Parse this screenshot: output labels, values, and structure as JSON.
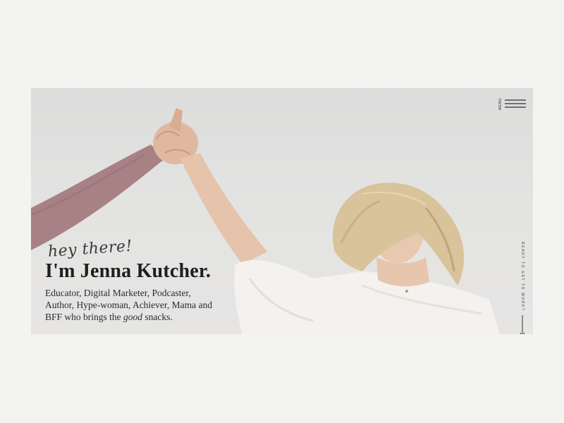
{
  "nav": {
    "menu_label": "MENU"
  },
  "hero": {
    "greeting": "hey there!",
    "headline": "I'm Jenna Kutcher.",
    "tagline_before": "Educator, Digital Marketer, Podcaster, Author, Hype-woman, Achiever, Mama and BFF who brings the ",
    "tagline_emphasis": "good",
    "tagline_after": " snacks.",
    "scroll_cue": "READY TO GET TO WORK?"
  },
  "icons": {
    "menu": "hamburger-icon",
    "scroll": "arrow-down-icon"
  },
  "colors": {
    "text": "#1e1e1e",
    "sleeve": "#a88184",
    "shirt": "#f4f2ee",
    "hair": "#d9c39b"
  }
}
